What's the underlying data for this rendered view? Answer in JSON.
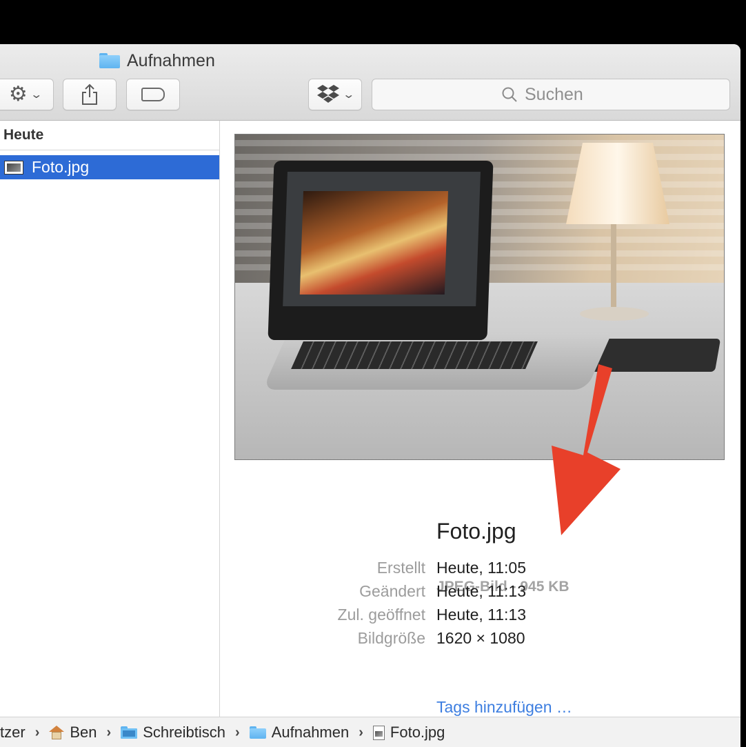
{
  "window": {
    "title": "Aufnahmen"
  },
  "toolbar": {
    "action_icon": "gear-icon",
    "share_icon": "share-icon",
    "tag_icon": "tag-icon",
    "dropbox_icon": "dropbox-icon",
    "search_placeholder": "Suchen"
  },
  "column": {
    "header": "Heute",
    "items": [
      {
        "name": "Foto.jpg",
        "selected": true
      }
    ]
  },
  "preview": {
    "filename": "Foto.jpg",
    "kind_size": "JPEG-Bild - 945 KB",
    "info": [
      {
        "label": "Erstellt",
        "value": "Heute, 11:05"
      },
      {
        "label": "Geändert",
        "value": "Heute, 11:13"
      },
      {
        "label": "Zul. geöffnet",
        "value": "Heute, 11:13"
      },
      {
        "label": "Bildgröße",
        "value": "1620 × 1080"
      }
    ],
    "tags_link": "Tags hinzufügen …"
  },
  "pathbar": {
    "items": [
      "tzer",
      "Ben",
      "Schreibtisch",
      "Aufnahmen",
      "Foto.jpg"
    ]
  },
  "colors": {
    "selection": "#2d6bd6",
    "link": "#3d7ee0",
    "annotation_arrow": "#e8402a"
  }
}
